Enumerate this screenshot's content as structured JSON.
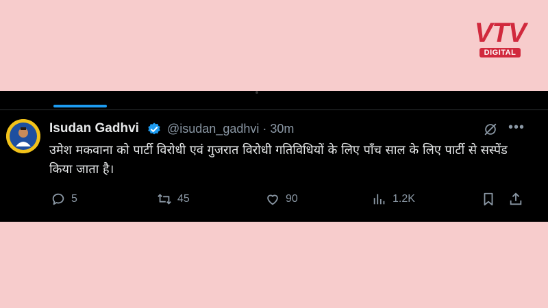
{
  "logo": {
    "brand": "VTV",
    "subtitle": "DIGITAL",
    "color": "#d1293d"
  },
  "tweet": {
    "author_name": "Isudan Gadhvi",
    "handle_time": "@isudan_gadhvi · 30m",
    "text": "उमेश मकवाना को पार्टी विरोधी एवं गुजरात विरोधी गतिविधियों के लिए पाँच साल के लिए पार्टी से सस्पेंड किया जाता है।",
    "replies": "5",
    "reposts": "45",
    "likes": "90",
    "views": "1.2K"
  },
  "colors": {
    "background": "#f7cccc",
    "panel": "#000000",
    "accent": "#1d9bf0",
    "muted": "#8b98a5"
  },
  "icons": [
    "verified-badge-icon",
    "hide-icon",
    "more-icon",
    "reply-icon",
    "retweet-icon",
    "like-icon",
    "views-icon",
    "bookmark-icon",
    "share-icon"
  ]
}
